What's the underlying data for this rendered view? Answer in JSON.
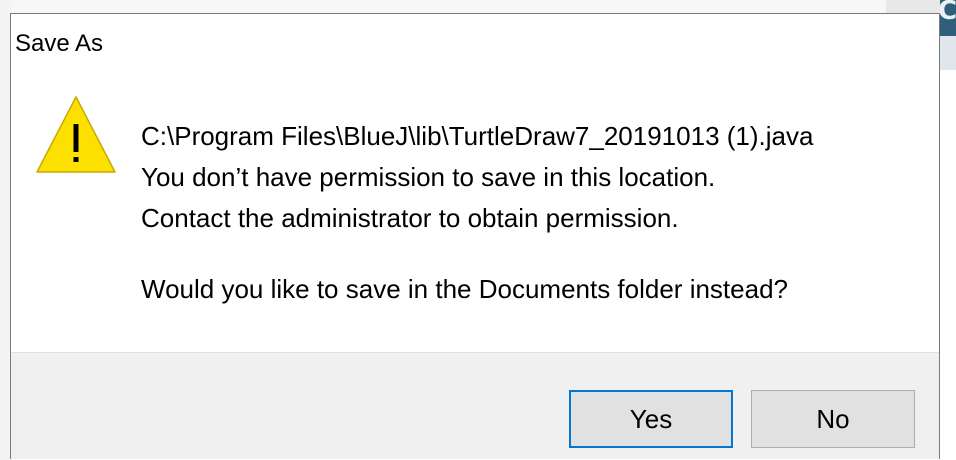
{
  "dialog": {
    "title": "Save As",
    "icon": "warning-icon",
    "message": {
      "path": "C:\\Program Files\\BlueJ\\lib\\TurtleDraw7_20191013 (1).java",
      "line1": "You don’t have permission to save in this location.",
      "line2": "Contact the administrator to obtain permission.",
      "question": "Would you like to save in the Documents folder instead?"
    },
    "buttons": {
      "yes": "Yes",
      "no": "No"
    }
  },
  "background": {
    "corner_text": "Co"
  },
  "colors": {
    "warning_fill": "#fce100",
    "warning_stroke": "#c9a800",
    "default_button_border": "#0078d7",
    "button_bar": "#f0f0f0"
  }
}
